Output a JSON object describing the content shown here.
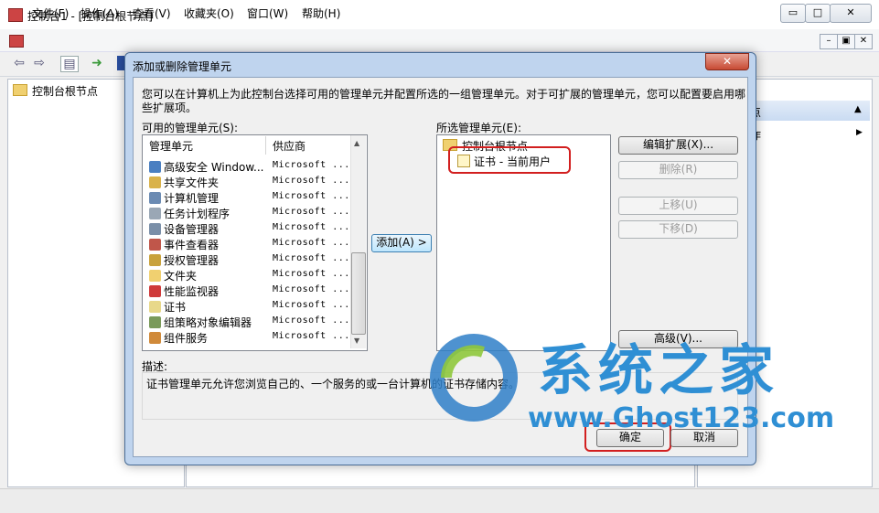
{
  "window": {
    "title": "控制台1 - [控制台根节点]",
    "minimize": "▭",
    "maximize": "□",
    "close": "✕"
  },
  "menu": {
    "items": [
      "文件(F)",
      "操作(A)",
      "查看(V)",
      "收藏夹(O)",
      "窗口(W)",
      "帮助(H)"
    ],
    "mdi_minimize": "–",
    "mdi_restore": "▣",
    "mdi_close": "✕"
  },
  "tree": {
    "root": "控制台根节点"
  },
  "actions": {
    "header": "点",
    "item": "作"
  },
  "dialog": {
    "title": "添加或删除管理单元",
    "close": "✕",
    "description": "您可以在计算机上为此控制台选择可用的管理单元并配置所选的一组管理单元。对于可扩展的管理单元，您可以配置要启用哪些扩展项。",
    "available_label": "可用的管理单元(S):",
    "selected_label": "所选管理单元(E):",
    "columns": {
      "snapin": "管理单元",
      "vendor": "供应商"
    },
    "rows": [
      {
        "name": "高级安全 Window...",
        "vendor": "Microsoft ...",
        "icon": "firewall-icon",
        "color": "#4a7fc1"
      },
      {
        "name": "共享文件夹",
        "vendor": "Microsoft ...",
        "icon": "shared-folder-icon",
        "color": "#d9b24a"
      },
      {
        "name": "计算机管理",
        "vendor": "Microsoft ...",
        "icon": "computer-management-icon",
        "color": "#6b8bb3"
      },
      {
        "name": "任务计划程序",
        "vendor": "Microsoft ...",
        "icon": "clock-icon",
        "color": "#9aa7b5"
      },
      {
        "name": "设备管理器",
        "vendor": "Microsoft ...",
        "icon": "device-manager-icon",
        "color": "#7a8fa8"
      },
      {
        "name": "事件查看器",
        "vendor": "Microsoft ...",
        "icon": "event-viewer-icon",
        "color": "#c0564a"
      },
      {
        "name": "授权管理器",
        "vendor": "Microsoft ...",
        "icon": "authorization-icon",
        "color": "#c9a23c"
      },
      {
        "name": "文件夹",
        "vendor": "Microsoft ...",
        "icon": "folder-icon",
        "color": "#f0d070"
      },
      {
        "name": "性能监视器",
        "vendor": "Microsoft ...",
        "icon": "performance-icon",
        "color": "#cf3a3a"
      },
      {
        "name": "证书",
        "vendor": "Microsoft ...",
        "icon": "certificate-icon",
        "color": "#e8d88a"
      },
      {
        "name": "组策略对象编辑器",
        "vendor": "Microsoft ...",
        "icon": "group-policy-icon",
        "color": "#7a9a5a"
      },
      {
        "name": "组件服务",
        "vendor": "Microsoft ...",
        "icon": "component-services-icon",
        "color": "#d08a3a"
      }
    ],
    "add_button": "添加(A) >",
    "selected_root": "控制台根节点",
    "selected_child": "证书 - 当前用户",
    "buttons": {
      "edit_ext": "编辑扩展(X)...",
      "remove": "删除(R)",
      "move_up": "上移(U)",
      "move_down": "下移(D)",
      "advanced": "高级(V)...",
      "ok": "确定",
      "cancel": "取消"
    },
    "desc_label": "描述:",
    "desc_text": "证书管理单元允许您浏览自己的、一个服务的或一台计算机的证书存储内容。"
  },
  "watermark": {
    "title": "系统之家",
    "url": "www.Ghost123.com"
  }
}
